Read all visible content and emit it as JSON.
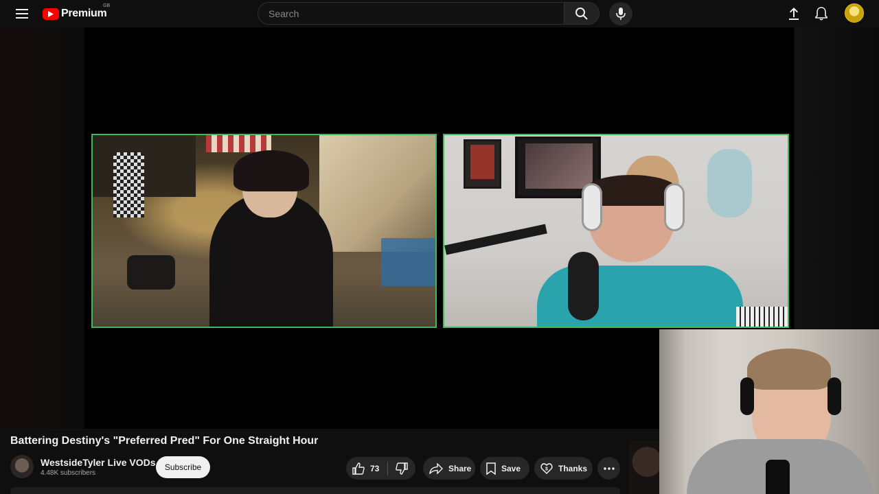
{
  "header": {
    "logo_text": "Premium",
    "logo_country": "GB",
    "search_placeholder": "Search"
  },
  "video": {
    "title": "Battering Destiny's \"Preferred Pred\" For One Straight Hour",
    "channel_name": "WestsideTyler Live VODs",
    "subscribers": "4.48K subscribers",
    "subscribe_label": "Subscribe",
    "likes": "73",
    "share_label": "Share",
    "save_label": "Save",
    "thanks_label": "Thanks"
  },
  "colors": {
    "accent": "#ff0000",
    "frame_border": "#3dbb5a",
    "background": "#0f0f0f"
  }
}
